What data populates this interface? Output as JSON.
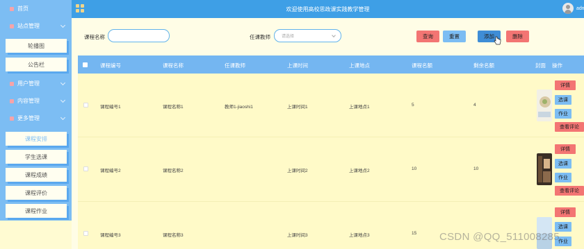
{
  "topbar": {
    "title": "欢迎使用高校思政课实践教学管理",
    "user": "adm"
  },
  "sidebar": {
    "home": "首页",
    "site_mgmt": "站点管理",
    "site_items": [
      "轮播图",
      "公告栏"
    ],
    "user_mgmt": "用户管理",
    "content_mgmt": "内容管理",
    "more_mgmt": "更多管理",
    "more_items": [
      "课程安排",
      "学生选课",
      "课程成绩",
      "课程评价",
      "课程作业"
    ]
  },
  "search": {
    "course_name_label": "课程名称",
    "course_name_value": "",
    "teacher_label": "任课教师",
    "teacher_placeholder": "请选择",
    "query_label": "查询",
    "reset_label": "重置",
    "add_label": "添加",
    "delete_label": "删除"
  },
  "table": {
    "headers": [
      "课程编号",
      "课程名称",
      "任课教师",
      "上课时间",
      "上课地点",
      "课程名额",
      "剩余名额",
      "封面",
      "操作"
    ],
    "rows": [
      {
        "code": "课程编号1",
        "name": "课程名称1",
        "teacher": "教师1-jiaoshi1",
        "time": "上课时间1",
        "place": "上课地点1",
        "quota": "5",
        "remaining": "4"
      },
      {
        "code": "课程编号2",
        "name": "课程名称2",
        "teacher": "",
        "time": "上课时间2",
        "place": "上课地点2",
        "quota": "10",
        "remaining": "10"
      },
      {
        "code": "课程编号3",
        "name": "课程名称3",
        "teacher": "",
        "time": "上课时间3",
        "place": "上课地点3",
        "quota": "15",
        "remaining": ""
      }
    ],
    "actions": {
      "detail": "详情",
      "select": "选课",
      "homework": "作业",
      "comments": "查看评论"
    }
  },
  "watermark": "CSDN @QQ_511008285",
  "colors": {
    "accent_blue": "#74b6f1",
    "topbar_blue": "#3e9fe6",
    "danger_red": "#f37573",
    "row_bg": "#fffac8"
  }
}
